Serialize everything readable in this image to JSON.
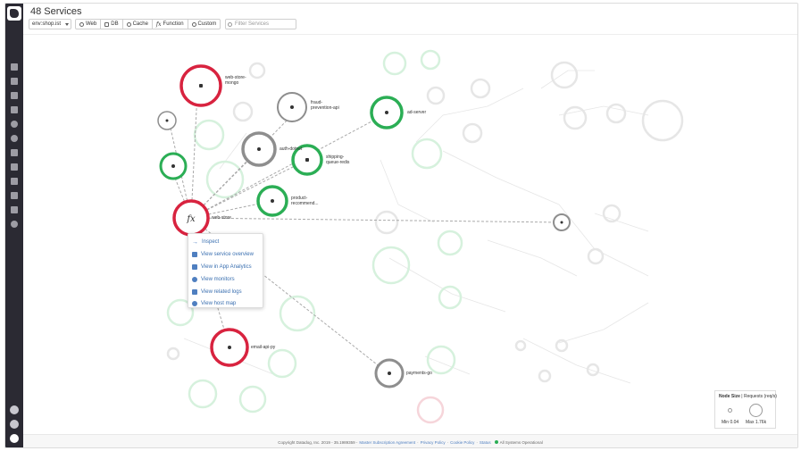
{
  "header": {
    "title": "48 Services",
    "env_value": "env:shop.ist",
    "filters": [
      {
        "label": "Web",
        "icon": "globe-icon"
      },
      {
        "label": "DB",
        "icon": "database-icon"
      },
      {
        "label": "Cache",
        "icon": "eye-icon"
      },
      {
        "label": "Function",
        "icon": "function-icon",
        "glyph": "fx"
      },
      {
        "label": "Custom",
        "icon": "custom-icon"
      }
    ],
    "search_placeholder": "Filter Services"
  },
  "colors": {
    "healthy": "#2bae55",
    "critical": "#d8233f",
    "neutral": "#8e8e8e",
    "faded_green": "#d6f1dd",
    "faded_grey": "#e6e6e6",
    "menu_link": "#3a6fb0",
    "sidebar": "#2b2a33"
  },
  "service_map": {
    "services": [
      {
        "name": "web-store-mongo",
        "label": "web-store-\nmongo",
        "status": "critical",
        "icon": "database-icon"
      },
      {
        "name": "fraud-prevention-api",
        "label": "fraud-\nprevention-api",
        "status": "neutral",
        "icon": "globe-icon"
      },
      {
        "name": "ad-server",
        "label": "ad-server",
        "status": "healthy",
        "icon": "globe-icon"
      },
      {
        "name": "auth-dotnet",
        "label": "auth-dotnet",
        "status": "neutral",
        "icon": "globe-icon"
      },
      {
        "name": "shipping-queue-redis",
        "label": "shipping-\nqueue-redis",
        "status": "healthy",
        "icon": "database-icon"
      },
      {
        "name": "product-recommend",
        "label": "product-\nrecommend...",
        "status": "healthy",
        "icon": "globe-icon"
      },
      {
        "name": "web-store",
        "label": "web-store",
        "status": "critical",
        "icon": "function-icon"
      },
      {
        "name": "email-api-py",
        "label": "email-api-py",
        "status": "critical",
        "icon": "globe-icon"
      },
      {
        "name": "payments-go",
        "label": "payments-go",
        "status": "neutral",
        "icon": "custom-icon"
      }
    ],
    "context_menu": [
      {
        "label": "Inspect",
        "icon": "arrow-icon"
      },
      {
        "label": "View service overview",
        "icon": "dashboard-icon"
      },
      {
        "label": "View in App Analytics",
        "icon": "analytics-icon"
      },
      {
        "label": "View monitors",
        "icon": "monitor-icon"
      },
      {
        "label": "View related logs",
        "icon": "logs-icon"
      },
      {
        "label": "View host map",
        "icon": "hostmap-icon"
      }
    ]
  },
  "legend": {
    "title_bold": "Node Size",
    "title_rest": " | Requests (req/s)",
    "min_label": "Min",
    "min_value": "0.04",
    "max_label": "Max",
    "max_value": "1.76k"
  },
  "footer": {
    "copyright": "Copyright Datadog, Inc. 2019 - 35.1989359 -",
    "link_msa": "Master Subscription Agreement",
    "sep1": "·",
    "link_privacy": "Privacy Policy",
    "sep2": "·",
    "link_cookie": "Cookie Policy",
    "sep3": "·",
    "link_status": "Status",
    "status_text": "All Systems Operational"
  }
}
